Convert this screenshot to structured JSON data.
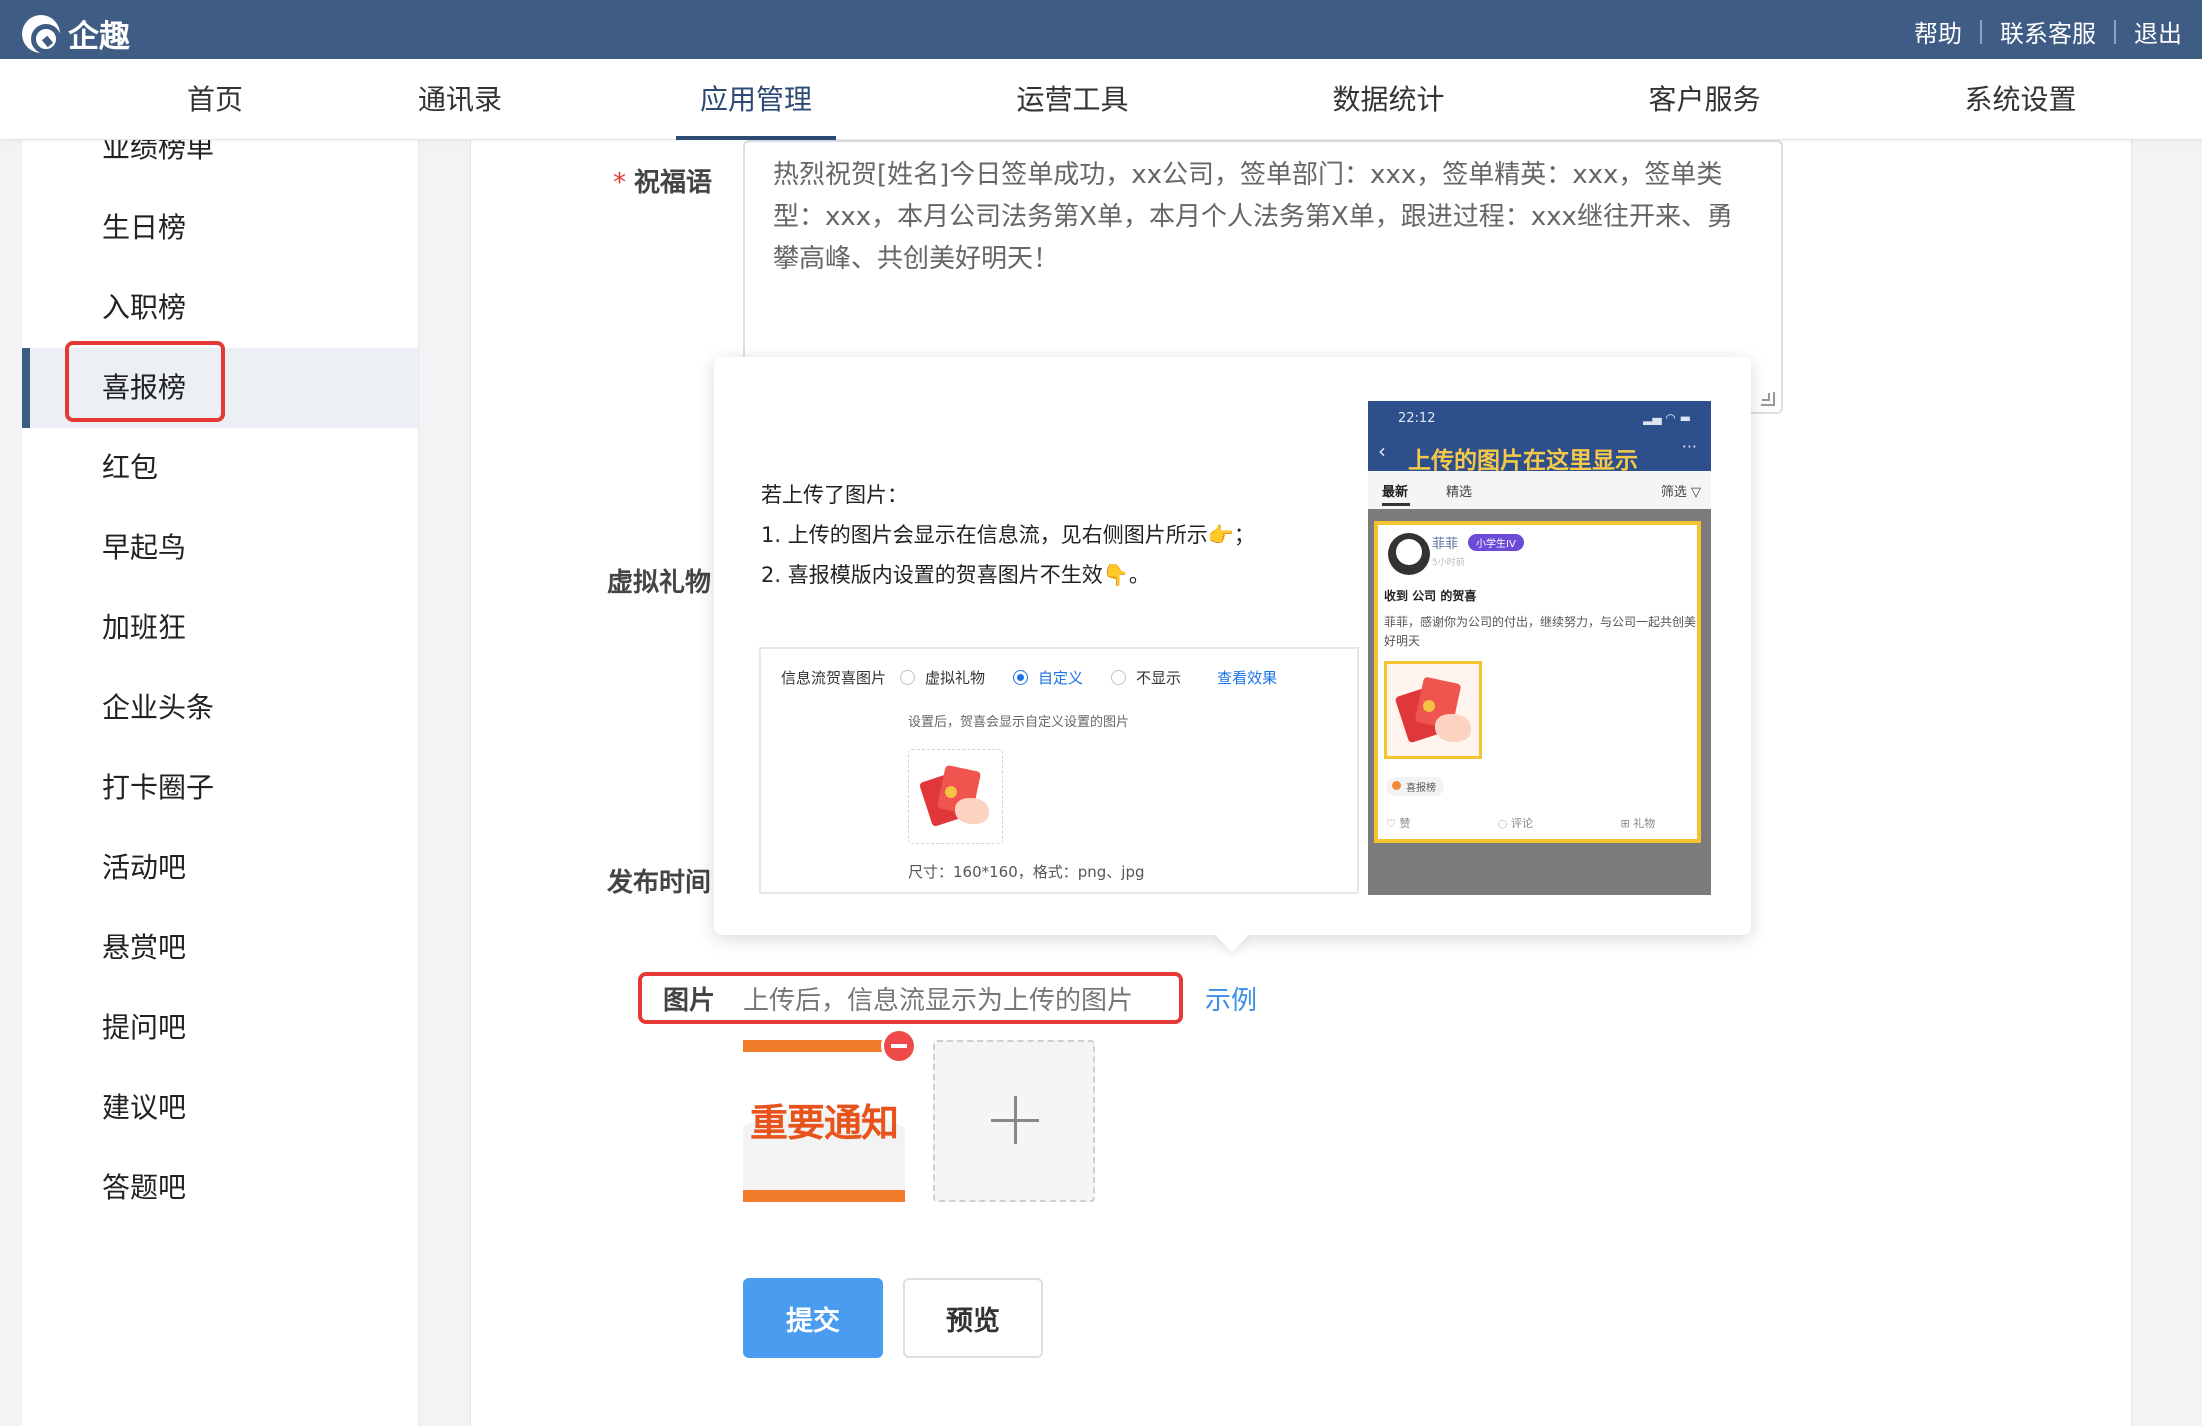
{
  "app": {
    "name": "企趣"
  },
  "top_links": [
    "帮助",
    "联系客服",
    "退出"
  ],
  "nav": {
    "items": [
      "首页",
      "通讯录",
      "应用管理",
      "运营工具",
      "数据统计",
      "客户服务",
      "系统设置"
    ],
    "active": "应用管理"
  },
  "sidebar": {
    "items": [
      "业绩榜单",
      "生日榜",
      "入职榜",
      "喜报榜",
      "红包",
      "早起鸟",
      "加班狂",
      "企业头条",
      "打卡圈子",
      "活动吧",
      "悬赏吧",
      "提问吧",
      "建议吧",
      "答题吧"
    ],
    "active": "喜报榜"
  },
  "form": {
    "greeting_label": "祝福语",
    "greeting_required": "*",
    "greeting_value": "热烈祝贺[姓名]今日签单成功，xx公司，签单部门：xxx，签单精英：xxx，签单类型：xxx，本月公司法务第X单，本月个人法务第X单，跟进过程：xxx继往开来、勇攀高峰、共创美好明天！",
    "virtual_gift_label": "虚拟礼物",
    "publish_time_label": "发布时间",
    "image_label": "图片",
    "image_hint": "上传后，信息流显示为上传的图片",
    "example_link": "示例",
    "submit": "提交",
    "preview": "预览"
  },
  "popover": {
    "lines": [
      "若上传了图片：",
      "1. 上传的图片会显示在信息流，见右侧图片所示👉；",
      "2. 喜报模版内设置的贺喜图片不生效👇。"
    ],
    "demo": {
      "field_label": "信息流贺喜图片",
      "options": [
        "虚拟礼物",
        "自定义",
        "不显示"
      ],
      "selected": "自定义",
      "view_effect": "查看效果",
      "hint": "设置后，贺喜会显示自定义设置的图片",
      "size_note": "尺寸：160*160，格式：png、jpg"
    },
    "phone": {
      "time": "22:12",
      "title": "上传的图片在这里显示",
      "tabs": [
        "最新",
        "精选",
        "筛选 ▽"
      ],
      "user_name": "菲菲",
      "badge": "小学生IV",
      "sub": "5小时前",
      "received": "收到 公司 的贺喜",
      "body": "菲菲，感谢你为公司的付出，继续努力，与公司一起共创美好明天",
      "tag": "喜报榜",
      "actions": [
        "赞",
        "评论",
        "礼物"
      ]
    }
  },
  "uploaded_image_text": "重要通知"
}
